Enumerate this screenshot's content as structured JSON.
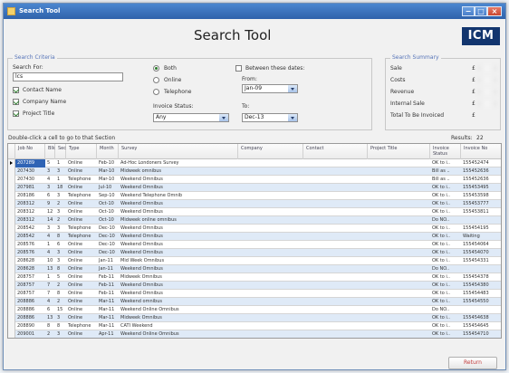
{
  "window": {
    "title": "Search Tool"
  },
  "header": {
    "title": "Search Tool",
    "logo": "ICM"
  },
  "search_criteria": {
    "legend": "Search Criteria",
    "search_for_label": "Search For:",
    "search_for_value": "lcs",
    "contact_name_label": "Contact Name",
    "company_name_label": "Company Name",
    "project_title_label": "Project Title",
    "options": {
      "both": "Both",
      "online": "Online",
      "telephone": "Telephone"
    },
    "between_dates_label": "Between these dates:",
    "from_label": "From:",
    "from_value": "Jan-09",
    "to_label": "To:",
    "to_value": "Dec-13",
    "invoice_status_label": "Invoice Status:",
    "invoice_status_value": "Any"
  },
  "search_summary": {
    "legend": "Search Summary",
    "sale_label": "Sale",
    "sale_value": "£",
    "costs_label": "Costs",
    "costs_value": "£",
    "revenue_label": "Revenue",
    "revenue_value": "£",
    "internal_sale_label": "Internal Sale",
    "internal_sale_value": "£",
    "total_to_be_invoiced_label": "Total To Be Invoiced",
    "total_to_be_invoiced_value": "£"
  },
  "grid_meta": {
    "hint": "Double-click a cell to go to that Section",
    "results_label": "Results:",
    "results_count": "22"
  },
  "grid": {
    "columns": [
      "Job No",
      "Blk",
      "Sec",
      "Type",
      "Month",
      "Survey",
      "Company",
      "Contact",
      "Project Title",
      "Invoice Status",
      "Invoice No"
    ],
    "rows": [
      {
        "job": "207289",
        "blk": "5",
        "sec": "1",
        "type": "Online",
        "month": "Feb-10",
        "survey": "Ad-Hoc Londoners Survey",
        "status": "OK to i..",
        "invoice": "155452474"
      },
      {
        "job": "207430",
        "blk": "3",
        "sec": "3",
        "type": "Online",
        "month": "Mar-10",
        "survey": "Midweek omnibus",
        "status": "Bill as ..",
        "invoice": "155452636"
      },
      {
        "job": "207430",
        "blk": "4",
        "sec": "1",
        "type": "Telephone",
        "month": "Mar-10",
        "survey": "Weekend Omnibus",
        "status": "Bill as ..",
        "invoice": "155452636"
      },
      {
        "job": "207981",
        "blk": "3",
        "sec": "18",
        "type": "Online",
        "month": "Jul-10",
        "survey": "Weekend Omnibus",
        "status": "OK to i..",
        "invoice": "155453495"
      },
      {
        "job": "208186",
        "blk": "6",
        "sec": "3",
        "type": "Telephone",
        "month": "Sep-10",
        "survey": "Weekend Telephone Omnib",
        "status": "OK to i..",
        "invoice": "155453598"
      },
      {
        "job": "208312",
        "blk": "9",
        "sec": "2",
        "type": "Online",
        "month": "Oct-10",
        "survey": "Weekend Omnibus",
        "status": "OK to i..",
        "invoice": "155453777"
      },
      {
        "job": "208312",
        "blk": "12",
        "sec": "3",
        "type": "Online",
        "month": "Oct-10",
        "survey": "Weekend Omnibus",
        "status": "OK to i..",
        "invoice": "155453811"
      },
      {
        "job": "208312",
        "blk": "14",
        "sec": "2",
        "type": "Online",
        "month": "Oct-10",
        "survey": "Midweek online omnibus",
        "status": "Do NO..",
        "invoice": ""
      },
      {
        "job": "208542",
        "blk": "3",
        "sec": "3",
        "type": "Telephone",
        "month": "Dec-10",
        "survey": "Weekend Omnibus",
        "status": "OK to i..",
        "invoice": "155454195"
      },
      {
        "job": "208542",
        "blk": "4",
        "sec": "8",
        "type": "Telephone",
        "month": "Dec-10",
        "survey": "Weekend Omnibus",
        "status": "OK to i..",
        "invoice": "Waiting"
      },
      {
        "job": "208576",
        "blk": "1",
        "sec": "6",
        "type": "Online",
        "month": "Dec-10",
        "survey": "Weekend Omnibus",
        "status": "OK to i..",
        "invoice": "155454064"
      },
      {
        "job": "208576",
        "blk": "4",
        "sec": "3",
        "type": "Online",
        "month": "Dec-10",
        "survey": "Weekend Omnibus",
        "status": "OK to i..",
        "invoice": "155454070"
      },
      {
        "job": "208628",
        "blk": "10",
        "sec": "3",
        "type": "Online",
        "month": "Jan-11",
        "survey": "Mid Week Omnibus",
        "status": "OK to i..",
        "invoice": "155454331"
      },
      {
        "job": "208628",
        "blk": "13",
        "sec": "8",
        "type": "Online",
        "month": "Jan-11",
        "survey": "Weekend Omnibus",
        "status": "Do NO..",
        "invoice": ""
      },
      {
        "job": "208757",
        "blk": "1",
        "sec": "5",
        "type": "Online",
        "month": "Feb-11",
        "survey": "Midweek Omnibus",
        "status": "OK to i..",
        "invoice": "155454378"
      },
      {
        "job": "208757",
        "blk": "7",
        "sec": "2",
        "type": "Online",
        "month": "Feb-11",
        "survey": "Weekend Omnibus",
        "status": "OK to i..",
        "invoice": "155454380"
      },
      {
        "job": "208757",
        "blk": "7",
        "sec": "8",
        "type": "Online",
        "month": "Feb-11",
        "survey": "Weekend Omnibus",
        "status": "OK to i..",
        "invoice": "155454483"
      },
      {
        "job": "208886",
        "blk": "4",
        "sec": "2",
        "type": "Online",
        "month": "Mar-11",
        "survey": "Weekend omnibus",
        "status": "OK to i..",
        "invoice": "155454550"
      },
      {
        "job": "208886",
        "blk": "6",
        "sec": "15",
        "type": "Online",
        "month": "Mar-11",
        "survey": "Weekend Online Omnibus",
        "status": "Do NO..",
        "invoice": ""
      },
      {
        "job": "208886",
        "blk": "13",
        "sec": "3",
        "type": "Online",
        "month": "Mar-11",
        "survey": "Midweek Omnibus",
        "status": "OK to i..",
        "invoice": "155454638"
      },
      {
        "job": "208890",
        "blk": "8",
        "sec": "8",
        "type": "Telephone",
        "month": "Mar-11",
        "survey": "CATI Weekend",
        "status": "OK to i..",
        "invoice": "155454645"
      },
      {
        "job": "209001",
        "blk": "2",
        "sec": "3",
        "type": "Online",
        "month": "Apr-11",
        "survey": "Weekend Online Omnibus",
        "status": "OK to i..",
        "invoice": "155454710"
      }
    ]
  },
  "footer": {
    "return_label": "Return"
  },
  "icons": {
    "window_icon": "app-window-icon",
    "selected_row": "row-selected-icon"
  }
}
